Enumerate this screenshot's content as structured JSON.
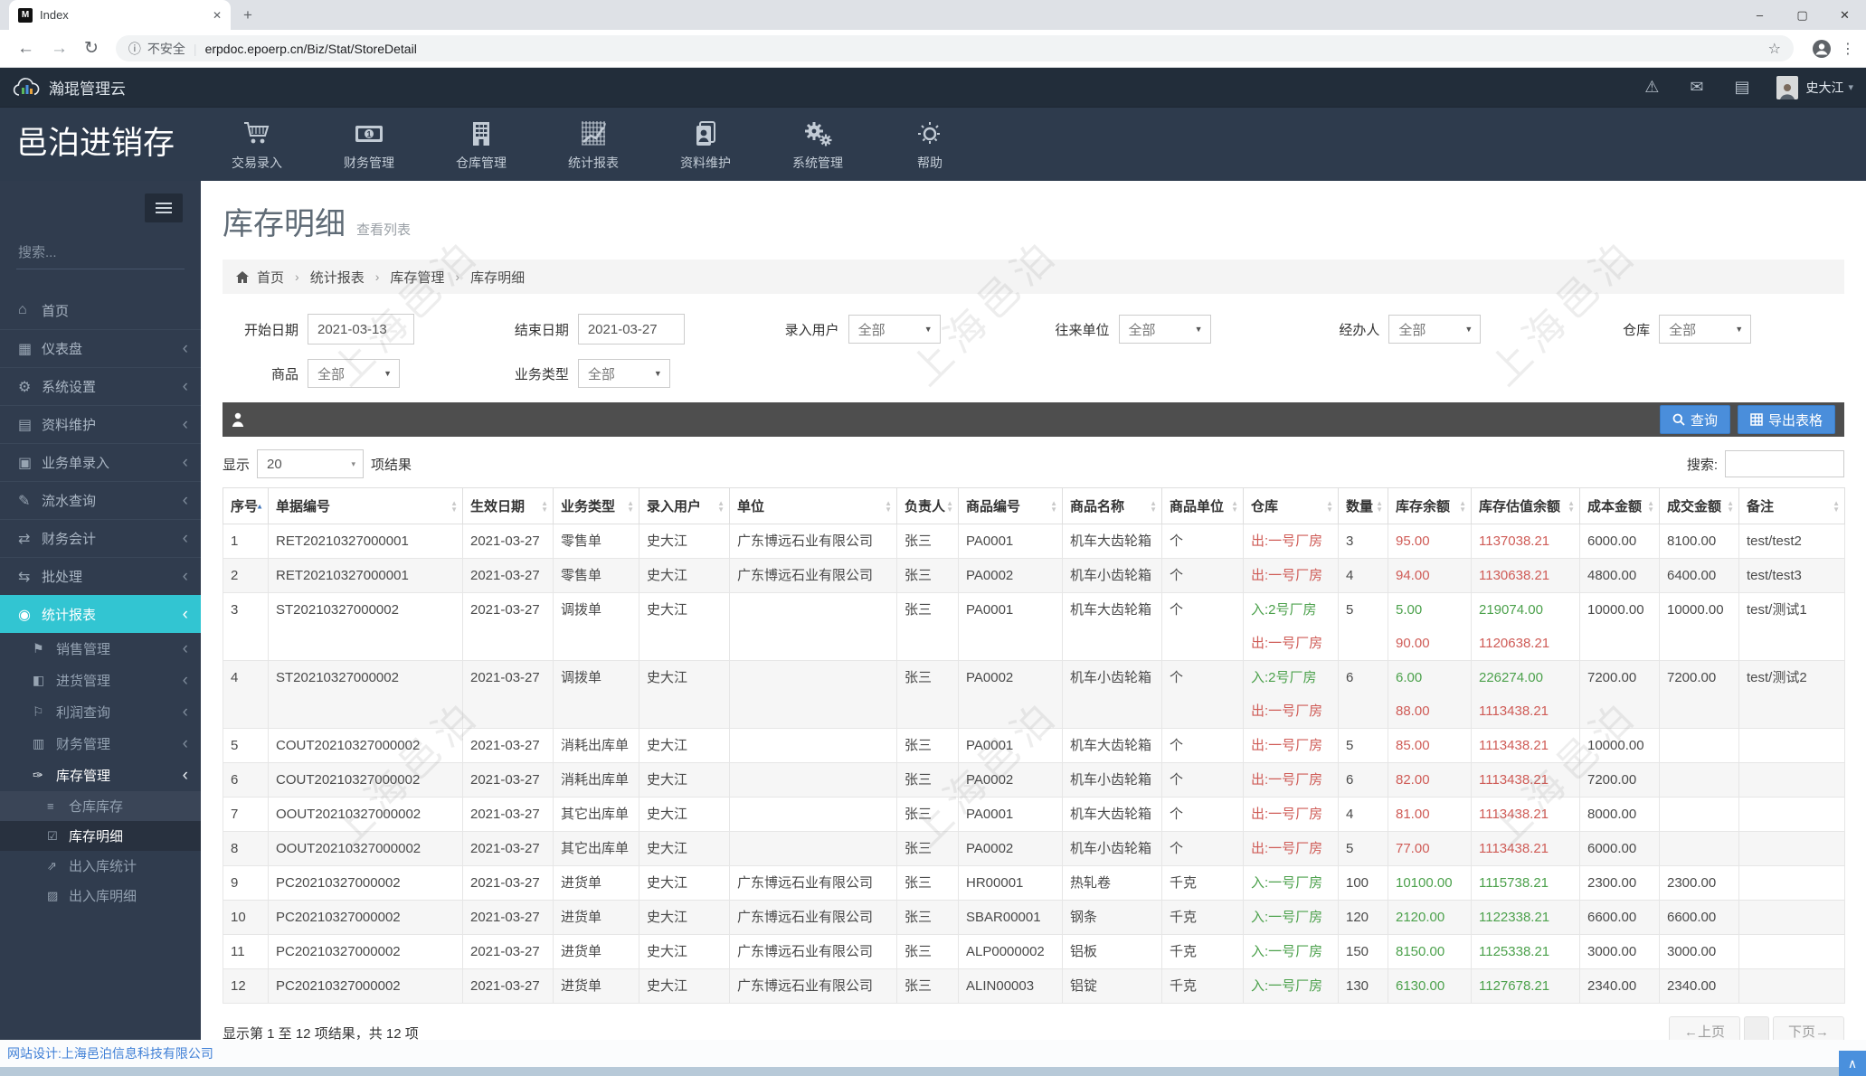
{
  "browser": {
    "tab_title": "Index",
    "favicon_letter": "M",
    "security_label": "不安全",
    "url": "erpdoc.epoerp.cn/Biz/Stat/StoreDetail"
  },
  "icons": {
    "minimize": "–",
    "maximize": "▢",
    "close": "✕",
    "tab_close": "✕",
    "new_tab": "+",
    "back": "←",
    "forward": "→",
    "reload": "↻",
    "info": "ⓘ",
    "star": "☆",
    "menu_dots": "⋮",
    "warning": "⚠",
    "mail": "✉",
    "list": "▤",
    "caret_down": "▾",
    "chevron_left": "‹",
    "breadcrumb_sep": "›",
    "sort_up": "▲",
    "sort_down": "▼",
    "back_to_top": "∧"
  },
  "app_header": {
    "brand": "瀚琨管理云",
    "user_name": "史大江"
  },
  "app_title": "邑泊进销存",
  "top_nav": [
    {
      "label": "交易录入",
      "icon": "cart-icon"
    },
    {
      "label": "财务管理",
      "icon": "banknote-icon"
    },
    {
      "label": "仓库管理",
      "icon": "warehouse-icon"
    },
    {
      "label": "统计报表",
      "icon": "chart-icon"
    },
    {
      "label": "资料维护",
      "icon": "idcard-icon"
    },
    {
      "label": "系统管理",
      "icon": "gears-icon"
    },
    {
      "label": "帮助",
      "icon": "help-icon"
    }
  ],
  "sidebar": {
    "search_placeholder": "搜索...",
    "items": [
      {
        "label": "首页",
        "icon": "home-icon",
        "glyph": "⌂"
      },
      {
        "label": "仪表盘",
        "icon": "dashboard-icon",
        "glyph": "▦",
        "expandable": true
      },
      {
        "label": "系统设置",
        "icon": "settings-icon",
        "glyph": "⚙",
        "expandable": true
      },
      {
        "label": "资料维护",
        "icon": "data-maintenance-icon",
        "glyph": "▤",
        "expandable": true
      },
      {
        "label": "业务单录入",
        "icon": "order-entry-icon",
        "glyph": "▣",
        "expandable": true
      },
      {
        "label": "流水查询",
        "icon": "journal-query-icon",
        "glyph": "✎",
        "expandable": true
      },
      {
        "label": "财务会计",
        "icon": "accounting-icon",
        "glyph": "⇄",
        "expandable": true
      },
      {
        "label": "批处理",
        "icon": "batch-icon",
        "glyph": "⇆",
        "expandable": true
      },
      {
        "label": "统计报表",
        "icon": "reports-icon",
        "glyph": "◉",
        "expandable": true,
        "active": true,
        "children": [
          {
            "label": "销售管理",
            "icon": "sales-icon",
            "glyph": "⚑",
            "expandable": true
          },
          {
            "label": "进货管理",
            "icon": "purchase-icon",
            "glyph": "◧",
            "expandable": true
          },
          {
            "label": "利润查询",
            "icon": "profit-icon",
            "glyph": "⚐",
            "expandable": true
          },
          {
            "label": "财务管理",
            "icon": "finance-icon",
            "glyph": "▥",
            "expandable": true
          },
          {
            "label": "库存管理",
            "icon": "inventory-icon",
            "glyph": "✑",
            "expandable": true,
            "open": true,
            "children": [
              {
                "label": "仓库库存",
                "icon": "warehouse-stock-icon",
                "glyph": "≡"
              },
              {
                "label": "库存明细",
                "icon": "stock-detail-icon",
                "glyph": "☑",
                "active": true
              },
              {
                "label": "出入库统计",
                "icon": "inout-stats-icon",
                "glyph": "⇗"
              },
              {
                "label": "出入库明细",
                "icon": "inout-detail-icon",
                "glyph": "▨"
              }
            ]
          }
        ]
      }
    ]
  },
  "page": {
    "title": "库存明细",
    "subtitle": "查看列表",
    "breadcrumb": [
      "首页",
      "统计报表",
      "库存管理",
      "库存明细"
    ]
  },
  "filters": {
    "row1": [
      {
        "label": "开始日期",
        "type": "input",
        "value": "2021-03-13"
      },
      {
        "label": "结束日期",
        "type": "input",
        "value": "2021-03-27"
      },
      {
        "label": "录入用户",
        "type": "select",
        "value": "全部"
      },
      {
        "label": "往来单位",
        "type": "select",
        "value": "全部"
      },
      {
        "label": "经办人",
        "type": "select",
        "value": "全部"
      },
      {
        "label": "仓库",
        "type": "select",
        "value": "全部"
      }
    ],
    "row2": [
      {
        "label": "商品",
        "type": "select",
        "value": "全部"
      },
      {
        "label": "业务类型",
        "type": "select",
        "value": "全部"
      }
    ]
  },
  "toolbar": {
    "query_label": "查询",
    "export_label": "导出表格"
  },
  "list_controls": {
    "show_label": "显示",
    "page_size": "20",
    "results_label": "项结果",
    "search_label": "搜索:"
  },
  "table": {
    "columns": [
      "序号",
      "单据编号",
      "生效日期",
      "业务类型",
      "录入用户",
      "单位",
      "负责人",
      "商品编号",
      "商品名称",
      "商品单位",
      "仓库",
      "数量",
      "库存余额",
      "库存估值余额",
      "成本金额",
      "成交金额",
      "备注"
    ],
    "rows": [
      [
        "1",
        "RET20210327000001",
        "2021-03-27",
        "零售单",
        "史大江",
        "广东博远石业有限公司",
        "张三",
        "PA0001",
        "机车大齿轮箱",
        "个",
        [
          {
            "t": "出:一号厂房",
            "c": "out"
          }
        ],
        "3",
        [
          {
            "t": "95.00",
            "c": "out"
          }
        ],
        [
          {
            "t": "1137038.21",
            "c": "out"
          }
        ],
        "6000.00",
        "8100.00",
        "test/test2"
      ],
      [
        "2",
        "RET20210327000001",
        "2021-03-27",
        "零售单",
        "史大江",
        "广东博远石业有限公司",
        "张三",
        "PA0002",
        "机车小齿轮箱",
        "个",
        [
          {
            "t": "出:一号厂房",
            "c": "out"
          }
        ],
        "4",
        [
          {
            "t": "94.00",
            "c": "out"
          }
        ],
        [
          {
            "t": "1130638.21",
            "c": "out"
          }
        ],
        "4800.00",
        "6400.00",
        "test/test3"
      ],
      [
        "3",
        "ST20210327000002",
        "2021-03-27",
        "调拨单",
        "史大江",
        "",
        "张三",
        "PA0001",
        "机车大齿轮箱",
        "个",
        [
          {
            "t": "入:2号厂房",
            "c": "in"
          },
          {
            "t": "出:一号厂房",
            "c": "out"
          }
        ],
        "5",
        [
          {
            "t": "5.00",
            "c": "in"
          },
          {
            "t": "90.00",
            "c": "out"
          }
        ],
        [
          {
            "t": "219074.00",
            "c": "in"
          },
          {
            "t": "1120638.21",
            "c": "out"
          }
        ],
        "10000.00",
        "10000.00",
        "test/测试1"
      ],
      [
        "4",
        "ST20210327000002",
        "2021-03-27",
        "调拨单",
        "史大江",
        "",
        "张三",
        "PA0002",
        "机车小齿轮箱",
        "个",
        [
          {
            "t": "入:2号厂房",
            "c": "in"
          },
          {
            "t": "出:一号厂房",
            "c": "out"
          }
        ],
        "6",
        [
          {
            "t": "6.00",
            "c": "in"
          },
          {
            "t": "88.00",
            "c": "out"
          }
        ],
        [
          {
            "t": "226274.00",
            "c": "in"
          },
          {
            "t": "1113438.21",
            "c": "out"
          }
        ],
        "7200.00",
        "7200.00",
        "test/测试2"
      ],
      [
        "5",
        "COUT20210327000002",
        "2021-03-27",
        "消耗出库单",
        "史大江",
        "",
        "张三",
        "PA0001",
        "机车大齿轮箱",
        "个",
        [
          {
            "t": "出:一号厂房",
            "c": "out"
          }
        ],
        "5",
        [
          {
            "t": "85.00",
            "c": "out"
          }
        ],
        [
          {
            "t": "1113438.21",
            "c": "out"
          }
        ],
        "10000.00",
        "",
        ""
      ],
      [
        "6",
        "COUT20210327000002",
        "2021-03-27",
        "消耗出库单",
        "史大江",
        "",
        "张三",
        "PA0002",
        "机车小齿轮箱",
        "个",
        [
          {
            "t": "出:一号厂房",
            "c": "out"
          }
        ],
        "6",
        [
          {
            "t": "82.00",
            "c": "out"
          }
        ],
        [
          {
            "t": "1113438.21",
            "c": "out"
          }
        ],
        "7200.00",
        "",
        ""
      ],
      [
        "7",
        "OOUT20210327000002",
        "2021-03-27",
        "其它出库单",
        "史大江",
        "",
        "张三",
        "PA0001",
        "机车大齿轮箱",
        "个",
        [
          {
            "t": "出:一号厂房",
            "c": "out"
          }
        ],
        "4",
        [
          {
            "t": "81.00",
            "c": "out"
          }
        ],
        [
          {
            "t": "1113438.21",
            "c": "out"
          }
        ],
        "8000.00",
        "",
        ""
      ],
      [
        "8",
        "OOUT20210327000002",
        "2021-03-27",
        "其它出库单",
        "史大江",
        "",
        "张三",
        "PA0002",
        "机车小齿轮箱",
        "个",
        [
          {
            "t": "出:一号厂房",
            "c": "out"
          }
        ],
        "5",
        [
          {
            "t": "77.00",
            "c": "out"
          }
        ],
        [
          {
            "t": "1113438.21",
            "c": "out"
          }
        ],
        "6000.00",
        "",
        ""
      ],
      [
        "9",
        "PC20210327000002",
        "2021-03-27",
        "进货单",
        "史大江",
        "广东博远石业有限公司",
        "张三",
        "HR00001",
        "热轧卷",
        "千克",
        [
          {
            "t": "入:一号厂房",
            "c": "in"
          }
        ],
        "100",
        [
          {
            "t": "10100.00",
            "c": "in"
          }
        ],
        [
          {
            "t": "1115738.21",
            "c": "in"
          }
        ],
        "2300.00",
        "2300.00",
        ""
      ],
      [
        "10",
        "PC20210327000002",
        "2021-03-27",
        "进货单",
        "史大江",
        "广东博远石业有限公司",
        "张三",
        "SBAR00001",
        "钢条",
        "千克",
        [
          {
            "t": "入:一号厂房",
            "c": "in"
          }
        ],
        "120",
        [
          {
            "t": "2120.00",
            "c": "in"
          }
        ],
        [
          {
            "t": "1122338.21",
            "c": "in"
          }
        ],
        "6600.00",
        "6600.00",
        ""
      ],
      [
        "11",
        "PC20210327000002",
        "2021-03-27",
        "进货单",
        "史大江",
        "广东博远石业有限公司",
        "张三",
        "ALP0000002",
        "铝板",
        "千克",
        [
          {
            "t": "入:一号厂房",
            "c": "in"
          }
        ],
        "150",
        [
          {
            "t": "8150.00",
            "c": "in"
          }
        ],
        [
          {
            "t": "1125338.21",
            "c": "in"
          }
        ],
        "3000.00",
        "3000.00",
        ""
      ],
      [
        "12",
        "PC20210327000002",
        "2021-03-27",
        "进货单",
        "史大江",
        "广东博远石业有限公司",
        "张三",
        "ALIN00003",
        "铝锭",
        "千克",
        [
          {
            "t": "入:一号厂房",
            "c": "in"
          }
        ],
        "130",
        [
          {
            "t": "6130.00",
            "c": "in"
          }
        ],
        [
          {
            "t": "1127678.21",
            "c": "in"
          }
        ],
        "2340.00",
        "2340.00",
        ""
      ]
    ]
  },
  "table_footer": {
    "summary": "显示第 1 至 12 项结果，共 12 项",
    "prev_label": "←上页",
    "next_label": "下页→"
  },
  "page_footer": {
    "text": "网站设计:上海邑泊信息科技有限公司"
  },
  "watermark": "上海邑泊",
  "colors": {
    "accent_teal": "#32c5d2",
    "button_blue": "#4a8edb",
    "in_green": "#4ca14c",
    "out_red": "#cf5b56"
  }
}
